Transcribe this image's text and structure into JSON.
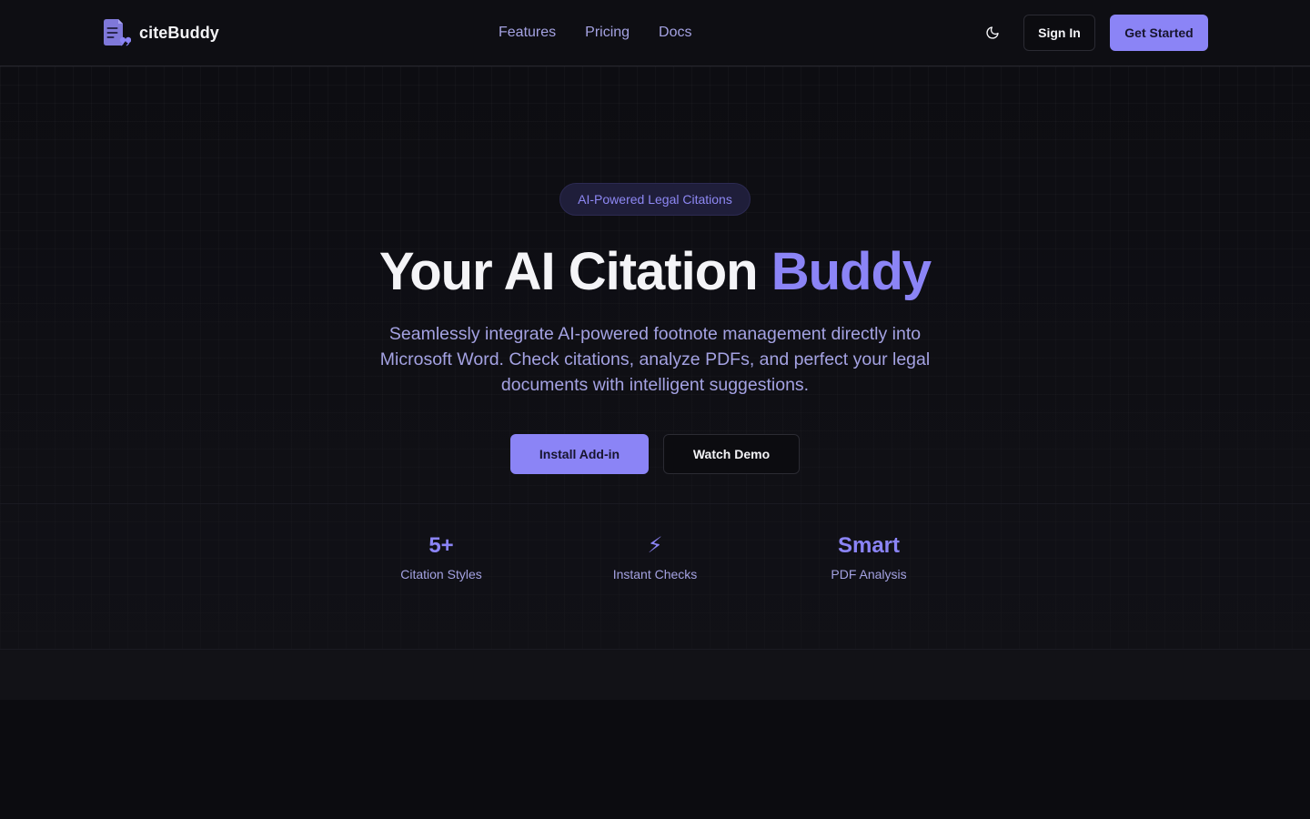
{
  "brand": {
    "name": "citeBuddy",
    "logo_icon": "document-quote-icon"
  },
  "nav": {
    "items": [
      {
        "label": "Features"
      },
      {
        "label": "Pricing"
      },
      {
        "label": "Docs"
      }
    ]
  },
  "header": {
    "theme_icon": "moon-icon",
    "sign_in_label": "Sign In",
    "get_started_label": "Get Started"
  },
  "hero": {
    "badge": "AI-Powered Legal Citations",
    "headline_main": "Your AI Citation ",
    "headline_accent": "Buddy",
    "subtext": "Seamlessly integrate AI-powered footnote management directly into Microsoft Word. Check citations, analyze PDFs, and perfect your legal documents with intelligent suggestions.",
    "primary_cta": "Install Add-in",
    "secondary_cta": "Watch Demo"
  },
  "stats": [
    {
      "value": "5+",
      "label": "Citation Styles"
    },
    {
      "value": "⚡",
      "label": "Instant Checks"
    },
    {
      "value": "Smart",
      "label": "PDF Analysis"
    }
  ],
  "colors": {
    "accent": "#8b84f6",
    "background": "#0c0c10",
    "muted_text": "#a4a2e2",
    "text": "#f4f4f7"
  }
}
